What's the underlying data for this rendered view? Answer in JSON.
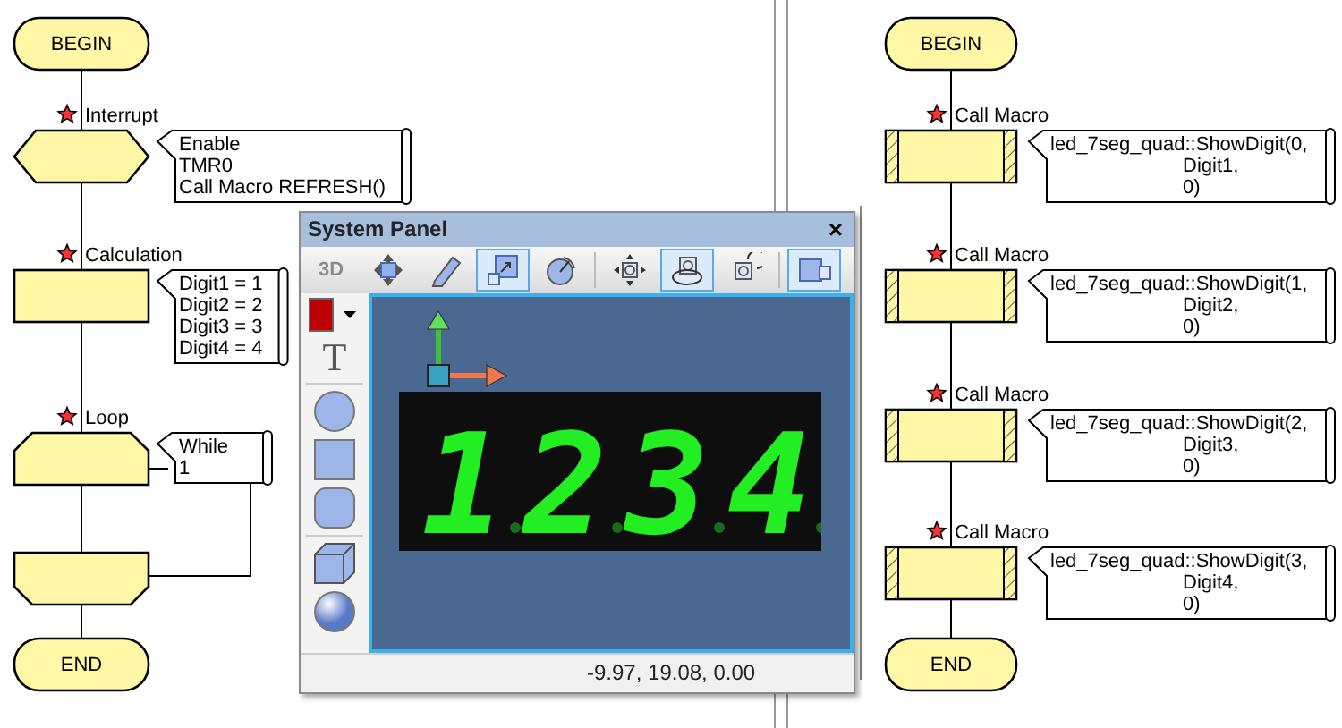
{
  "left_flowchart": {
    "nodes": [
      {
        "kind": "terminal",
        "label": "BEGIN"
      },
      {
        "kind": "interrupt",
        "caption": "Interrupt",
        "comment": [
          "Enable",
          "TMR0",
          "Call Macro REFRESH()"
        ]
      },
      {
        "kind": "calculation",
        "caption": "Calculation",
        "comment": [
          "Digit1 = 1",
          "Digit2 = 2",
          "Digit3 = 3",
          "Digit4 = 4"
        ]
      },
      {
        "kind": "loop_start",
        "caption": "Loop",
        "comment": [
          "While",
          "1"
        ]
      },
      {
        "kind": "loop_end"
      },
      {
        "kind": "terminal",
        "label": "END"
      }
    ]
  },
  "right_flowchart": {
    "nodes": [
      {
        "kind": "terminal",
        "label": "BEGIN"
      },
      {
        "kind": "macro",
        "caption": "Call Macro",
        "comment": [
          "led_7seg_quad::ShowDigit(0,",
          "Digit1,",
          "0)"
        ]
      },
      {
        "kind": "macro",
        "caption": "Call Macro",
        "comment": [
          "led_7seg_quad::ShowDigit(1,",
          "Digit2,",
          "0)"
        ]
      },
      {
        "kind": "macro",
        "caption": "Call Macro",
        "comment": [
          "led_7seg_quad::ShowDigit(2,",
          "Digit3,",
          "0)"
        ]
      },
      {
        "kind": "macro",
        "caption": "Call Macro",
        "comment": [
          "led_7seg_quad::ShowDigit(3,",
          "Digit4,",
          "0)"
        ]
      },
      {
        "kind": "terminal",
        "label": "END"
      }
    ]
  },
  "system_panel": {
    "title": "System Panel",
    "close": "×",
    "toolbar": [
      {
        "kind": "text",
        "label": "3D",
        "disabled": true,
        "selected": false
      },
      {
        "kind": "move",
        "selected": false
      },
      {
        "kind": "pencil",
        "selected": false
      },
      {
        "kind": "scale",
        "selected": true
      },
      {
        "kind": "rotate",
        "selected": false
      },
      {
        "kind": "separator"
      },
      {
        "kind": "pan",
        "selected": false
      },
      {
        "kind": "orbit",
        "selected": true
      },
      {
        "kind": "spin",
        "selected": false
      },
      {
        "kind": "separator"
      },
      {
        "kind": "view",
        "selected": true
      }
    ],
    "tools": [
      {
        "kind": "swatch",
        "color": "#c00000"
      },
      {
        "kind": "text",
        "label": "T"
      },
      {
        "kind": "separator"
      },
      {
        "kind": "circle"
      },
      {
        "kind": "square"
      },
      {
        "kind": "rounded"
      },
      {
        "kind": "separator"
      },
      {
        "kind": "cube"
      },
      {
        "kind": "sphere"
      }
    ],
    "display": {
      "digits": [
        "1",
        "2",
        "3",
        "4"
      ]
    },
    "status": "-9.97, 19.08, 0.00"
  }
}
